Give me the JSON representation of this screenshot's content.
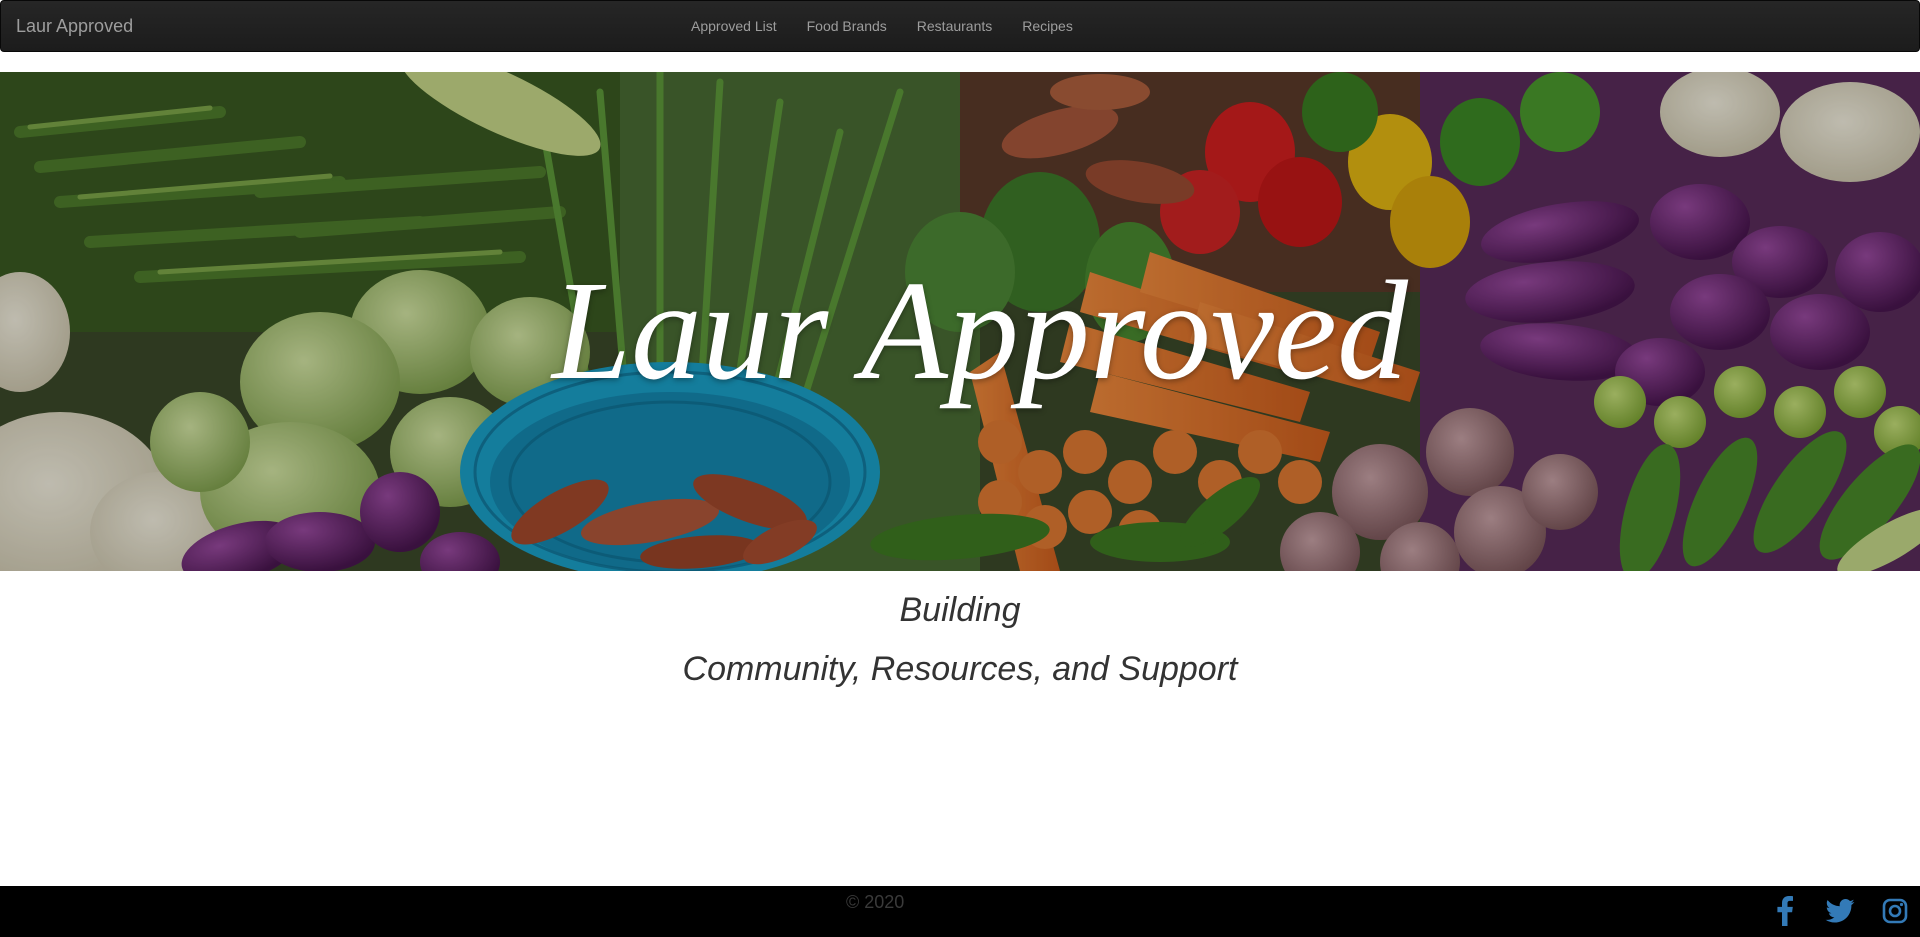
{
  "navbar": {
    "brand": "Laur Approved",
    "links": [
      {
        "label": "Approved List"
      },
      {
        "label": "Food Brands"
      },
      {
        "label": "Restaurants"
      },
      {
        "label": "Recipes"
      }
    ]
  },
  "hero": {
    "title": "Laur Approved",
    "image": "fresh-vegetables-market-photo"
  },
  "tagline": {
    "line1": "Building",
    "line2": "Community, Resources, and Support"
  },
  "footer": {
    "copyright": "© 2020",
    "social": [
      {
        "icon": "facebook-icon"
      },
      {
        "icon": "twitter-icon"
      },
      {
        "icon": "instagram-icon"
      }
    ]
  },
  "colors": {
    "navbar_bg": "#222222",
    "nav_text": "#9d9d9d",
    "social_icon": "#337ab7",
    "footer_bg": "#000000"
  }
}
